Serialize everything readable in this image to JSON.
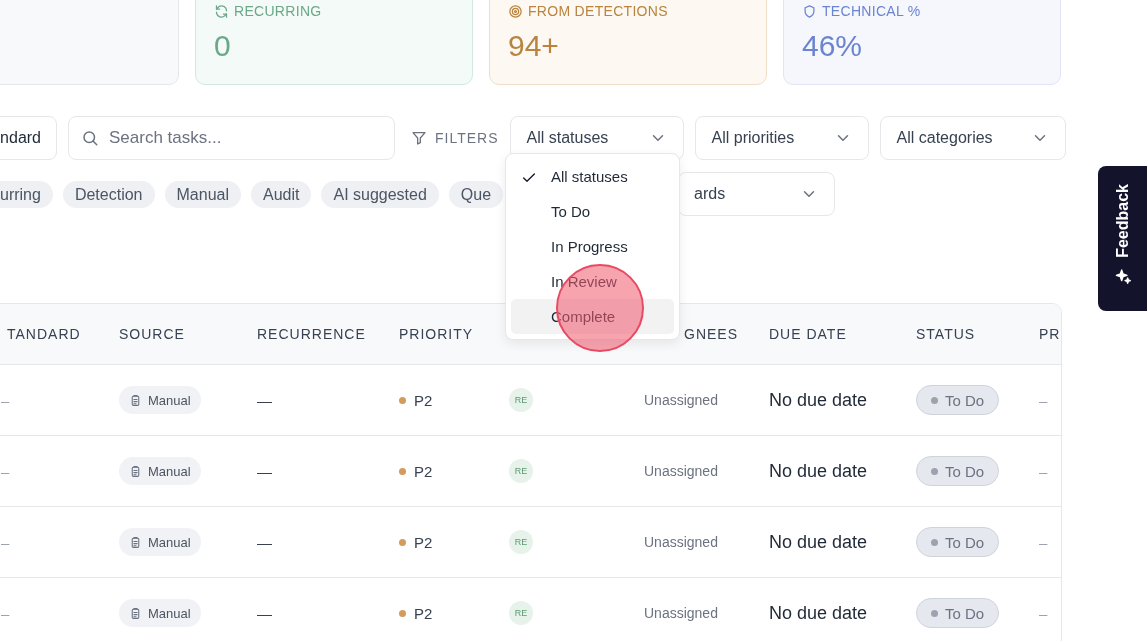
{
  "stat_cards": [
    {
      "kind": "blank"
    },
    {
      "kind": "recurring",
      "label": "RECURRING",
      "value": "0",
      "color": "#6aa888"
    },
    {
      "kind": "detections",
      "label": "FROM DETECTIONS",
      "value": "94+",
      "color": "#b8843e"
    },
    {
      "kind": "technical",
      "label": "TECHNICAL %",
      "value": "46%",
      "color": "#6a84cf"
    }
  ],
  "toolbar": {
    "standard_button": "ndard",
    "search": {
      "placeholder": "Search tasks..."
    },
    "filters_label": "FILTERS",
    "dropdowns": [
      "All statuses",
      "All priorities",
      "All categories"
    ]
  },
  "chips": [
    "urring",
    "Detection",
    "Manual",
    "Audit",
    "AI suggested",
    "Que"
  ],
  "second_dropdown": "ards",
  "status_menu": {
    "items": [
      {
        "label": "All statuses",
        "selected": true,
        "highlighted": false
      },
      {
        "label": "To Do",
        "selected": false,
        "highlighted": false
      },
      {
        "label": "In Progress",
        "selected": false,
        "highlighted": false
      },
      {
        "label": "In Review",
        "selected": false,
        "highlighted": false
      },
      {
        "label": "Complete",
        "selected": false,
        "highlighted": true
      }
    ]
  },
  "click_marker": true,
  "table": {
    "columns": [
      {
        "kind": "text",
        "label": "TANDARD"
      },
      {
        "kind": "text",
        "label": "SOURCE"
      },
      {
        "kind": "text",
        "label": "RECURRENCE"
      },
      {
        "kind": "text",
        "label": "PRIORITY"
      },
      {
        "kind": "covered"
      },
      {
        "kind": "text",
        "label": "GNEES"
      },
      {
        "kind": "text",
        "label": "DUE DATE"
      },
      {
        "kind": "text",
        "label": "STATUS"
      },
      {
        "kind": "text",
        "label": "PR"
      }
    ],
    "rows": [
      {
        "standard": "–",
        "source": "Manual",
        "recurrence": "—",
        "priority": "P2",
        "owner": "RE",
        "assignees": "Unassigned",
        "due_date": "No due date",
        "status": "To Do",
        "column_9": "–"
      },
      {
        "standard": "–",
        "source": "Manual",
        "recurrence": "—",
        "priority": "P2",
        "owner": "RE",
        "assignees": "Unassigned",
        "due_date": "No due date",
        "status": "To Do",
        "column_9": "–"
      },
      {
        "standard": "–",
        "source": "Manual",
        "recurrence": "—",
        "priority": "P2",
        "owner": "RE",
        "assignees": "Unassigned",
        "due_date": "No due date",
        "status": "To Do",
        "column_9": "–"
      },
      {
        "standard": "–",
        "source": "Manual",
        "recurrence": "—",
        "priority": "P2",
        "owner": "RE",
        "assignees": "Unassigned",
        "due_date": "No due date",
        "status": "To Do",
        "column_9": "–"
      }
    ]
  },
  "feedback": {
    "label": "Feedback"
  }
}
